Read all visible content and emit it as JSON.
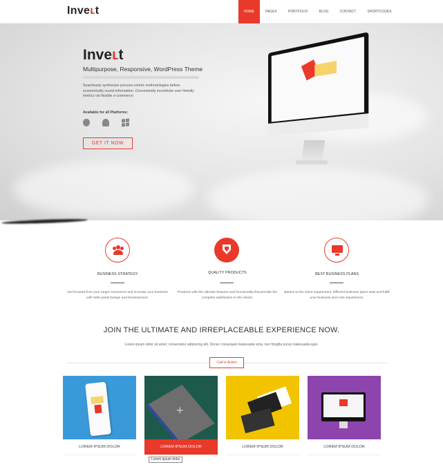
{
  "brand": {
    "name_main": "Inve",
    "name_accent": "ʟ",
    "name_end": "t",
    "accent_color": "#e8392b"
  },
  "nav": {
    "items": [
      "HOME",
      "PAGES",
      "PORTFOLIO",
      "BLOG",
      "CONTACT",
      "SHORTCODES"
    ],
    "active": "HOME"
  },
  "hero": {
    "subtitle": "Multipurpose, Responsive, WordPress Theme",
    "description": "Seamlessly synthesize process-centric methodologies before economically sound information. Conveniently incentivize user friendly metrics via flexible e-commerce.",
    "platforms_label": "Available for all  Platforms:",
    "platform_icons": [
      "apple-icon",
      "android-icon",
      "windows-icon"
    ],
    "button": "GET IT NOW"
  },
  "features": [
    {
      "icon": "users-icon",
      "title": "BUSINESS STRATEGY",
      "desc": "Get focused from your target consumers and increase your business with Web portal Design and Development."
    },
    {
      "icon": "shield-icon",
      "title": "QUALITY PRODUCTS",
      "desc": "Products with the ultimate features and functionality that provide the complete satisfaction to the clients."
    },
    {
      "icon": "monitor-icon",
      "title": "BEST BUSINESS PLANS",
      "desc": "Based on the client requirement, different business plans suits and fulfill your business and cost requirement."
    }
  ],
  "join": {
    "title": "JOIN THE ULTIMATE AND IRREPLACEABLE EXPERIENCE NOW.",
    "desc": "Lorem ipsum dolor sit amet, consectetur adipiscing elit. Donec consequat malesuada urna, non fringilla purus malesuada eget.",
    "cta": "Call to Action"
  },
  "portfolio": {
    "items": [
      {
        "caption": "LOREM IPSUM DOLOR",
        "color": "#3a9ad9"
      },
      {
        "caption": "LOREM IPSUM DOLOR",
        "color": "#1e5a4c"
      },
      {
        "caption": "LOREM IPSUM DOLOR",
        "color": "#f2c400"
      },
      {
        "caption": "LOREM IPSUM DOLOR",
        "color": "#8e44ad"
      }
    ],
    "tooltip": "Lorem ipsum dolor"
  }
}
